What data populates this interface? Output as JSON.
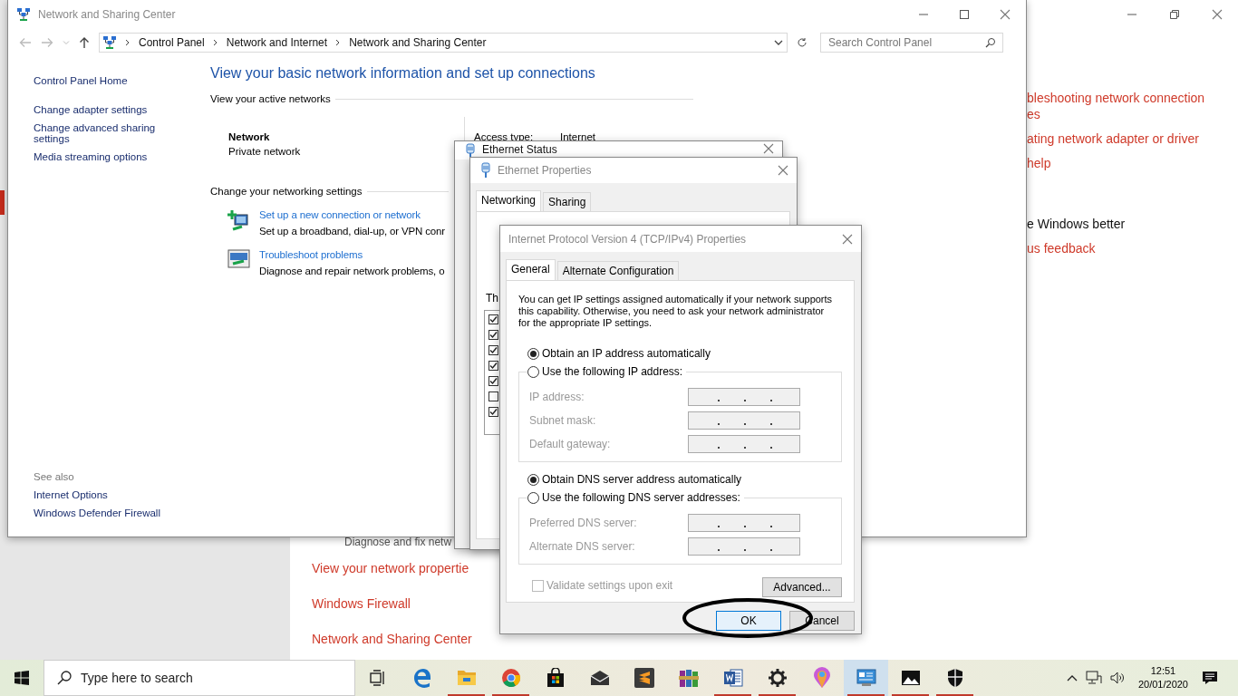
{
  "settings_window": {
    "links_top": [
      {
        "text": "bleshooting network connection",
        "kind": "link"
      },
      {
        "text": "es",
        "kind": "link"
      },
      {
        "text": "ating network adapter or driver",
        "kind": "link"
      },
      {
        "text": "help",
        "kind": "link"
      },
      {
        "text": "e Windows better",
        "kind": "heading"
      },
      {
        "text": "us feedback",
        "kind": "link"
      }
    ],
    "diagnose_text": "Diagnose and fix netw",
    "links_bottom": [
      "View your network propertie",
      "Windows Firewall",
      "Network and Sharing Center"
    ]
  },
  "nsc_window": {
    "title": "Network and Sharing Center",
    "breadcrumb": [
      "Control Panel",
      "Network and Internet",
      "Network and Sharing Center"
    ],
    "search": {
      "placeholder": "Search Control Panel"
    },
    "sidebar": {
      "items": [
        "Control Panel Home",
        "Change adapter settings",
        "Change advanced sharing settings",
        "Media streaming options"
      ],
      "see_also_heading": "See also",
      "see_also": [
        "Internet Options",
        "Windows Defender Firewall"
      ]
    },
    "heading": "View your basic network information and set up connections",
    "active_networks_label": "View your active networks",
    "network": {
      "name": "Network",
      "category": "Private network"
    },
    "access_type_label": "Access type:",
    "access_type_value": "Internet",
    "settings_label": "Change your networking settings",
    "tasks": [
      {
        "kind": "setup",
        "title": "Set up a new connection or network",
        "description": "Set up a broadband, dial-up, or VPN conr"
      },
      {
        "kind": "troubleshoot",
        "title": "Troubleshoot problems",
        "description": "Diagnose and repair network problems, o"
      }
    ]
  },
  "ethernet_status": {
    "title": "Ethernet Status"
  },
  "ethernet_properties": {
    "title": "Ethernet Properties",
    "tabs": [
      {
        "label": "Networking",
        "selected": true
      },
      {
        "label": "Sharing",
        "selected": false
      }
    ],
    "list_label": "Th",
    "items": [
      {
        "checked": true
      },
      {
        "checked": true
      },
      {
        "checked": true
      },
      {
        "checked": true
      },
      {
        "checked": true
      },
      {
        "checked": false
      },
      {
        "checked": true
      }
    ]
  },
  "ipv4_dialog": {
    "title": "Internet Protocol Version 4 (TCP/IPv4) Properties",
    "tabs": [
      {
        "label": "General",
        "selected": true
      },
      {
        "label": "Alternate Configuration",
        "selected": false
      }
    ],
    "intro": "You can get IP settings assigned automatically if your network supports this capability. Otherwise, you need to ask your network administrator for the appropriate IP settings.",
    "ip_options": [
      {
        "label": "Obtain an IP address automatically",
        "selected": true
      },
      {
        "label": "Use the following IP address:",
        "selected": false
      }
    ],
    "ip_fields": [
      "IP address:",
      "Subnet mask:",
      "Default gateway:"
    ],
    "dns_options": [
      {
        "label": "Obtain DNS server address automatically",
        "selected": true
      },
      {
        "label": "Use the following DNS server addresses:",
        "selected": false
      }
    ],
    "dns_fields": [
      "Preferred DNS server:",
      "Alternate DNS server:"
    ],
    "validate": {
      "label": "Validate settings upon exit",
      "checked": false
    },
    "advanced": "Advanced...",
    "ok": "OK",
    "cancel": "Cancel"
  },
  "taskbar": {
    "search_placeholder": "Type here to search",
    "apps": [
      {
        "kind": "taskview",
        "running": false,
        "active": false
      },
      {
        "kind": "edge",
        "running": false,
        "active": false
      },
      {
        "kind": "explorer",
        "running": true,
        "active": false
      },
      {
        "kind": "chrome",
        "running": true,
        "active": false
      },
      {
        "kind": "store",
        "running": false,
        "active": false
      },
      {
        "kind": "mail",
        "running": false,
        "active": false
      },
      {
        "kind": "sublime",
        "running": false,
        "active": false
      },
      {
        "kind": "winrar",
        "running": false,
        "active": false
      },
      {
        "kind": "word",
        "running": true,
        "active": false
      },
      {
        "kind": "settings",
        "running": true,
        "active": false
      },
      {
        "kind": "paint3d",
        "running": false,
        "active": false
      },
      {
        "kind": "controlpanel",
        "running": true,
        "active": true
      },
      {
        "kind": "photos",
        "running": true,
        "active": false
      },
      {
        "kind": "defender",
        "running": true,
        "active": false
      }
    ],
    "time": "12:51",
    "date": "20/01/2020"
  }
}
